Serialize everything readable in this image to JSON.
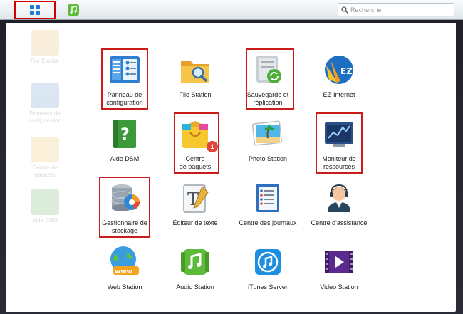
{
  "taskbar": {
    "main_menu_icon": "grid-icon",
    "audio_icon": "audio-station-icon",
    "search_placeholder": "Recherche"
  },
  "ghost_icons": [
    {
      "label": "File Station"
    },
    {
      "label": "Panneau de configuration"
    },
    {
      "label": "Centre de paquets"
    },
    {
      "label": "Aide DSM"
    }
  ],
  "apps": [
    {
      "label": "Panneau de\nconfiguration",
      "icon": "control-panel-icon",
      "highlighted": true
    },
    {
      "label": "File Station",
      "icon": "file-station-icon",
      "highlighted": false
    },
    {
      "label": "Sauvegarde et\nréplication",
      "icon": "backup-replication-icon",
      "highlighted": true
    },
    {
      "label": "EZ-Internet",
      "icon": "ez-internet-icon",
      "highlighted": false
    },
    {
      "label": "Aide DSM",
      "icon": "dsm-help-icon",
      "highlighted": false
    },
    {
      "label": "Centre\nde paquets",
      "icon": "package-center-icon",
      "highlighted": true,
      "badge": "1"
    },
    {
      "label": "Photo Station",
      "icon": "photo-station-icon",
      "highlighted": false
    },
    {
      "label": "Moniteur de\nressources",
      "icon": "resource-monitor-icon",
      "highlighted": true
    },
    {
      "label": "Gestionnaire de\nstockage",
      "icon": "storage-manager-icon",
      "highlighted": true
    },
    {
      "label": "Éditeur de texte",
      "icon": "text-editor-icon",
      "highlighted": false
    },
    {
      "label": "Centre des journaux",
      "icon": "log-center-icon",
      "highlighted": false
    },
    {
      "label": "Centre d'assistance",
      "icon": "support-center-icon",
      "highlighted": false
    },
    {
      "label": "Web Station",
      "icon": "web-station-icon",
      "highlighted": false
    },
    {
      "label": "Audio Station",
      "icon": "audio-station-icon",
      "highlighted": false
    },
    {
      "label": "iTunes Server",
      "icon": "itunes-server-icon",
      "highlighted": false
    },
    {
      "label": "Video Station",
      "icon": "video-station-icon",
      "highlighted": false
    }
  ],
  "colors": {
    "highlight": "#cc1b1b",
    "taskbar_top": "#fafbfc",
    "badge": "#e0473a"
  }
}
